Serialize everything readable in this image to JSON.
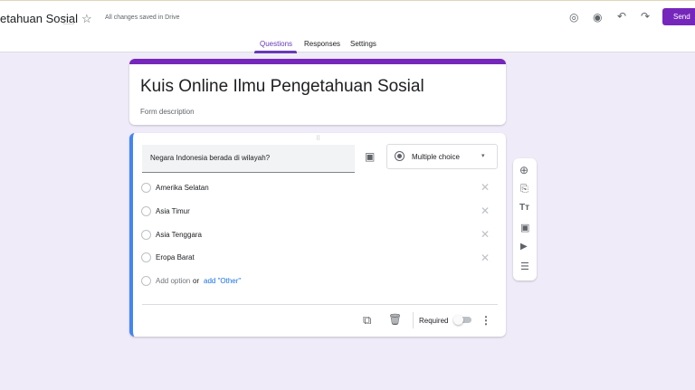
{
  "header": {
    "title": "etahuan Sosial",
    "saved_status": "All changes saved in Drive",
    "send_label": "Send",
    "icons": [
      "folder-icon",
      "star-icon",
      "palette-icon",
      "preview-eye-icon",
      "undo-icon",
      "redo-icon"
    ]
  },
  "tabs": [
    {
      "label": "Questions",
      "active": true
    },
    {
      "label": "Responses"
    },
    {
      "label": "Settings"
    }
  ],
  "form": {
    "title": "Kuis Online Ilmu Pengetahuan Sosial",
    "description_placeholder": "Form description"
  },
  "question": {
    "text": "Negara Indonesia berada di wilayah?",
    "type": "Multiple choice",
    "options": [
      "Amerika Selatan",
      "Asia Timur",
      "Asia Tenggara",
      "Eropa Barat"
    ],
    "add_option": "Add option",
    "or": "or",
    "add_other": "add \"Other\"",
    "required_label": "Required",
    "required": false
  },
  "side_toolbar": [
    "add-question-icon",
    "import-questions-icon",
    "title-text-icon",
    "image-icon",
    "video-icon",
    "section-icon"
  ],
  "colors": {
    "accent": "#673ab7",
    "active_border": "#4285f4",
    "background": "#f0ebf8"
  }
}
